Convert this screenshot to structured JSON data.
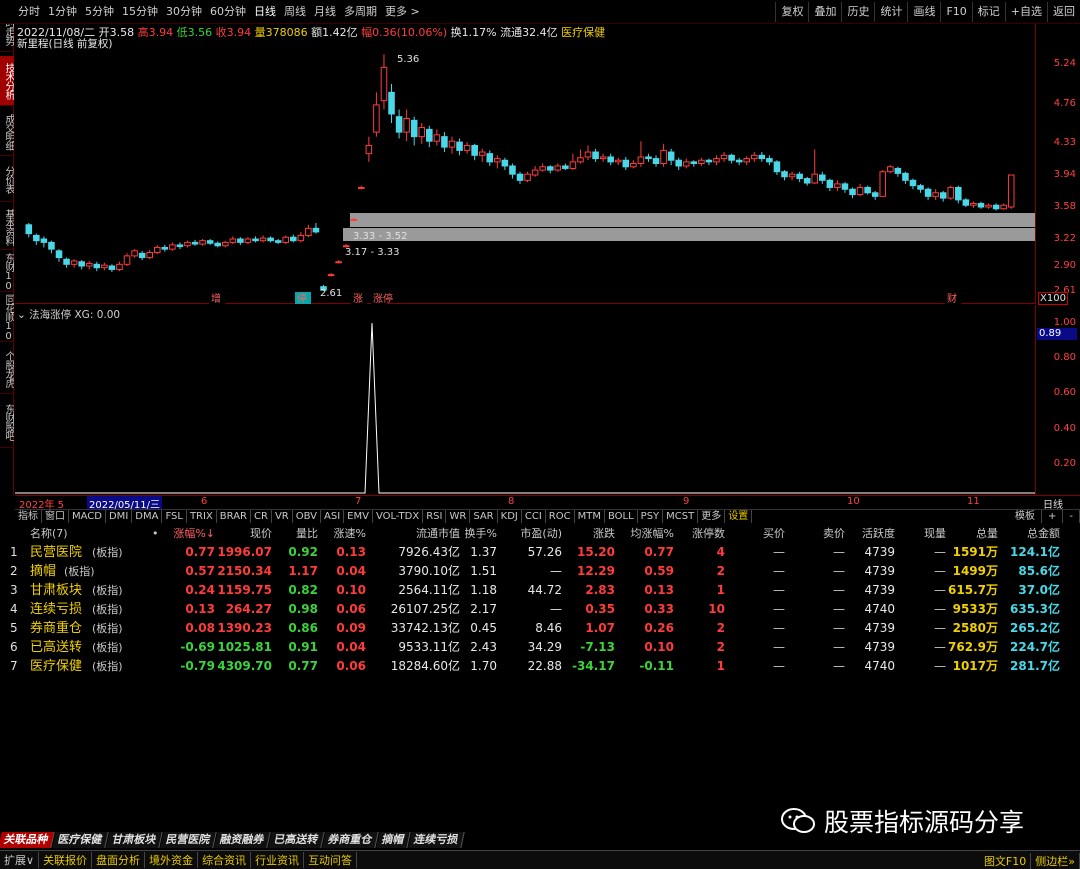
{
  "toolbar": {
    "periods": [
      "分时",
      "1分钟",
      "5分钟",
      "15分钟",
      "30分钟",
      "60分钟",
      "日线",
      "周线",
      "月线",
      "多周期",
      "更多 >"
    ],
    "active_period": "日线",
    "right": [
      "复权",
      "叠加",
      "历史",
      "统计",
      "画线",
      "F10",
      "标记",
      "+自选",
      "返回"
    ]
  },
  "left_tabs": [
    "分时走势",
    "技术分析",
    "成交明细",
    "分价表",
    "基本资料",
    "东财10",
    "同花顺10",
    "个股龙虎",
    "东财股吧"
  ],
  "info": {
    "date": "2022/11/08/二",
    "open_label": "开",
    "open": "3.58",
    "high_label": "高",
    "high": "3.94",
    "low_label": "低",
    "low": "3.56",
    "close_label": "收",
    "close": "3.94",
    "vol_label": "量",
    "vol": "378086",
    "amount_label": "额",
    "amount": "1.42亿",
    "change_label": "幅",
    "change": "0.36(10.06%)",
    "turnover_label": "换",
    "turnover": "1.17%",
    "float_label": "流通",
    "float": "32.4亿",
    "sector": "医疗保健"
  },
  "chart_title": "新里程(日线 前复权)",
  "price_axis": [
    "5.24",
    "4.76",
    "4.33",
    "3.94",
    "3.58",
    "3.22",
    "2.90",
    "2.61"
  ],
  "annotations": {
    "high_mark": "5.36",
    "low_mark": "2.61",
    "gap1": "3.33 - 3.52",
    "gap2": "3.17 - 3.33",
    "zoom": "X100"
  },
  "event_markers": [
    "增",
    "停",
    "涨",
    "涨停",
    "财"
  ],
  "indicator": {
    "title": "法海涨停 XG: 0.00",
    "axis": [
      "1.00",
      "0.80",
      "0.60",
      "0.40",
      "0.20"
    ],
    "current": "0.89"
  },
  "dates": {
    "labels": [
      "2022年 5",
      "6",
      "7",
      "8",
      "9",
      "10",
      "11"
    ],
    "selected": "2022/05/11/三",
    "period_label": "日线"
  },
  "indicator_tabs": [
    "指标",
    "窗口",
    "MACD",
    "DMI",
    "DMA",
    "FSL",
    "TRIX",
    "BRAR",
    "CR",
    "VR",
    "OBV",
    "ASI",
    "EMV",
    "VOL-TDX",
    "RSI",
    "WR",
    "SAR",
    "KDJ",
    "CCI",
    "ROC",
    "MTM",
    "BOLL",
    "PSY",
    "MCST",
    "更多",
    "设置"
  ],
  "indicator_tabs_right": [
    "模板",
    "+",
    "-"
  ],
  "table": {
    "headers": [
      "名称(7)",
      "•",
      "涨幅%↓",
      "现价",
      "量比",
      "涨速%",
      "流通市值",
      "换手%",
      "市盈(动)",
      "涨跌",
      "均涨幅%",
      "涨停数",
      "买价",
      "卖价",
      "活跃度",
      "现量",
      "总量",
      "总金额"
    ],
    "rows": [
      {
        "idx": "1",
        "name": "民营医院",
        "tag": "(板指)",
        "chg": "0.77",
        "price": "1996.07",
        "vr": "0.92",
        "spd": "0.13",
        "mv": "7926.43亿",
        "turn": "1.37",
        "pe": "57.26",
        "diff": "15.20",
        "avg": "0.77",
        "lim": "4",
        "bid": "—",
        "ask": "—",
        "act": "4739",
        "cur": "—",
        "vol": "1591万",
        "amt": "124.1亿",
        "up": true
      },
      {
        "idx": "2",
        "name": "摘帽",
        "tag": "(板指)",
        "chg": "0.57",
        "price": "2150.34",
        "vr": "1.17",
        "spd": "0.04",
        "mv": "3790.10亿",
        "turn": "1.51",
        "pe": "—",
        "diff": "12.29",
        "avg": "0.59",
        "lim": "2",
        "bid": "—",
        "ask": "—",
        "act": "4739",
        "cur": "—",
        "vol": "1499万",
        "amt": "85.6亿",
        "up": true
      },
      {
        "idx": "3",
        "name": "甘肃板块",
        "tag": "(板指)",
        "chg": "0.24",
        "price": "1159.75",
        "vr": "0.82",
        "spd": "0.10",
        "mv": "2564.11亿",
        "turn": "1.18",
        "pe": "44.72",
        "diff": "2.83",
        "avg": "0.13",
        "lim": "1",
        "bid": "—",
        "ask": "—",
        "act": "4739",
        "cur": "—",
        "vol": "615.7万",
        "amt": "37.0亿",
        "up": true
      },
      {
        "idx": "4",
        "name": "连续亏损",
        "tag": "(板指)",
        "chg": "0.13",
        "price": "264.27",
        "vr": "0.98",
        "spd": "0.06",
        "mv": "26107.25亿",
        "turn": "2.17",
        "pe": "—",
        "diff": "0.35",
        "avg": "0.33",
        "lim": "10",
        "bid": "—",
        "ask": "—",
        "act": "4740",
        "cur": "—",
        "vol": "9533万",
        "amt": "635.3亿",
        "up": true
      },
      {
        "idx": "5",
        "name": "券商重仓",
        "tag": "(板指)",
        "chg": "0.08",
        "price": "1390.23",
        "vr": "0.86",
        "spd": "0.09",
        "mv": "33742.13亿",
        "turn": "0.45",
        "pe": "8.46",
        "diff": "1.07",
        "avg": "0.26",
        "lim": "2",
        "bid": "—",
        "ask": "—",
        "act": "4739",
        "cur": "—",
        "vol": "2580万",
        "amt": "265.2亿",
        "up": true
      },
      {
        "idx": "6",
        "name": "已高送转",
        "tag": "(板指)",
        "chg": "-0.69",
        "price": "1025.81",
        "vr": "0.91",
        "spd": "0.04",
        "mv": "9533.11亿",
        "turn": "2.43",
        "pe": "34.29",
        "diff": "-7.13",
        "avg": "0.10",
        "lim": "2",
        "bid": "—",
        "ask": "—",
        "act": "4739",
        "cur": "—",
        "vol": "762.9万",
        "amt": "224.7亿",
        "up": false
      },
      {
        "idx": "7",
        "name": "医疗保健",
        "tag": "(板指)",
        "chg": "-0.79",
        "price": "4309.70",
        "vr": "0.77",
        "spd": "0.06",
        "mv": "18284.60亿",
        "turn": "1.70",
        "pe": "22.88",
        "diff": "-34.17",
        "avg": "-0.11",
        "lim": "1",
        "bid": "—",
        "ask": "—",
        "act": "4740",
        "cur": "—",
        "vol": "1017万",
        "amt": "281.7亿",
        "up": false
      }
    ]
  },
  "sector_tabs": [
    "关联品种",
    "医疗保健",
    "甘肃板块",
    "民营医院",
    "融资融券",
    "已高送转",
    "券商重仓",
    "摘帽",
    "连续亏损"
  ],
  "status_bar": [
    "扩展∨",
    "关联报价",
    "盘面分析",
    "境外资金",
    "综合资讯",
    "行业资讯",
    "互动问答"
  ],
  "status_right": [
    "图文F10",
    "侧边栏»"
  ],
  "watermark": "股票指标源码分享",
  "colors": {
    "up": "#ff3c3c",
    "down": "#3cd33c",
    "candle_down": "#4ad8e8",
    "accent": "#b00000"
  }
}
